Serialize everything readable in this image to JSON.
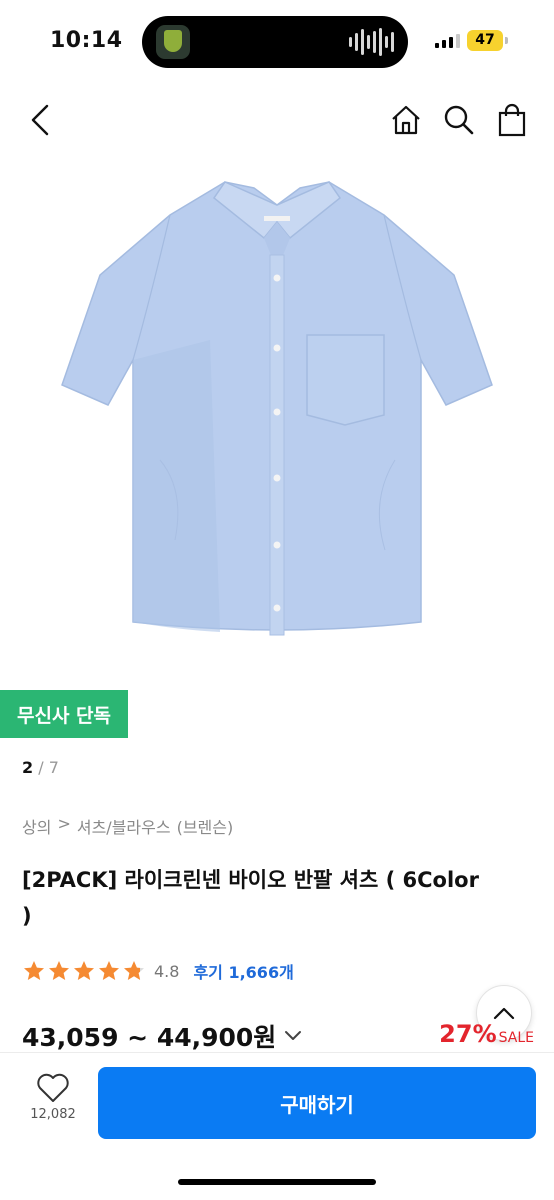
{
  "status": {
    "time": "10:14",
    "battery": "47"
  },
  "nav": {
    "back_icon": "chevron-left-icon",
    "home_icon": "home-icon",
    "search_icon": "search-icon",
    "cart_icon": "shopping-bag-icon"
  },
  "product": {
    "image_description_icon": "shirt-image",
    "shirt_color": "#b7cdee",
    "exclusive_badge": "무신사 단독",
    "pager": {
      "current": "2",
      "separator": " / ",
      "total": "7"
    },
    "breadcrumb": [
      "상의",
      ">",
      "셔츠/블라우스",
      "(브렌슨)"
    ],
    "title": "[2PACK] 라이크린넨 바이오 반팔 셔츠 ( 6Color )",
    "rating": {
      "stars": 4.8,
      "value": "4.8",
      "review_label": "후기 1,666개"
    },
    "price": "43,059 ~ 44,900원",
    "discount_percent": "27%",
    "sale_label": "SALE"
  },
  "bottom": {
    "like_count": "12,082",
    "buy_label": "구매하기"
  },
  "colors": {
    "accent_blue": "#0a7bf3",
    "badge_green": "#2bb673",
    "sale_red": "#e3252d",
    "star_orange": "#f58a32",
    "review_blue": "#1f6ad9"
  }
}
